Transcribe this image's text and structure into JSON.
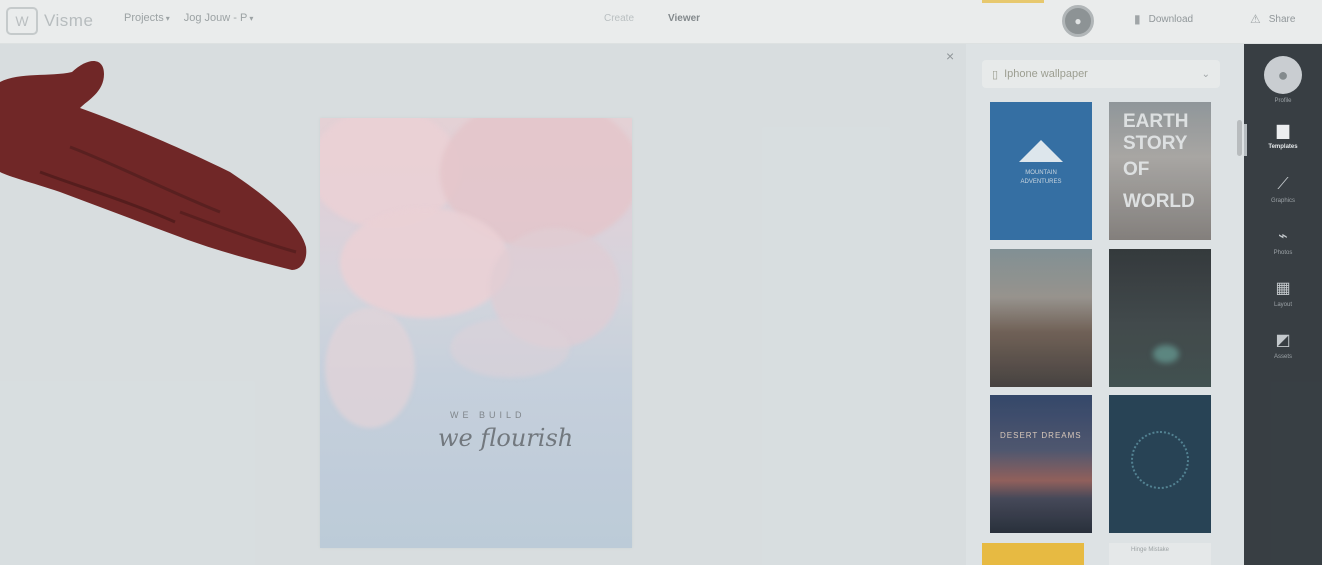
{
  "app": {
    "logo_text": "Visme"
  },
  "menu": {
    "items": [
      "Projects",
      "Jog Jouw - P"
    ]
  },
  "tabs": {
    "create": "Create",
    "viewer": "Viewer"
  },
  "topbar": {
    "avatar_icon": "user-icon",
    "download_label": "Download",
    "share_label": "Share"
  },
  "canvas": {
    "close_glyph": "×",
    "poster": {
      "small_text": "WE BUILD",
      "script_text": "we flourish"
    }
  },
  "templates": {
    "dropdown_label": "Iphone wallpaper",
    "cards": [
      {
        "name": "template-blue-mountain",
        "lines": [
          "MOUNTAIN",
          "ADVENTURES"
        ]
      },
      {
        "name": "template-earth-story",
        "lines": [
          "EARTH",
          "STORY",
          "OF",
          "WORLD"
        ]
      },
      {
        "name": "template-sunset-cliff",
        "lines": []
      },
      {
        "name": "template-night-tent",
        "lines": []
      },
      {
        "name": "template-twilight",
        "lines": [
          "DESERT DREAMS"
        ]
      },
      {
        "name": "template-teal-pattern",
        "lines": []
      },
      {
        "name": "template-yellow",
        "lines": []
      },
      {
        "name": "template-white",
        "lines": [
          "Hinge Mistake"
        ]
      }
    ]
  },
  "sidenav": {
    "items": [
      {
        "icon": "avatar-icon",
        "label": "Profile"
      },
      {
        "icon": "templates-icon",
        "label": "Templates"
      },
      {
        "icon": "graphics-icon",
        "label": "Graphics"
      },
      {
        "icon": "photos-icon",
        "label": "Photos"
      },
      {
        "icon": "layout-icon",
        "label": "Layout"
      },
      {
        "icon": "assets-icon",
        "label": "Assets"
      }
    ]
  },
  "colors": {
    "sidenav_bg": "#2f363b",
    "accent": "#e9c869",
    "hand": "#6b1d1d"
  }
}
